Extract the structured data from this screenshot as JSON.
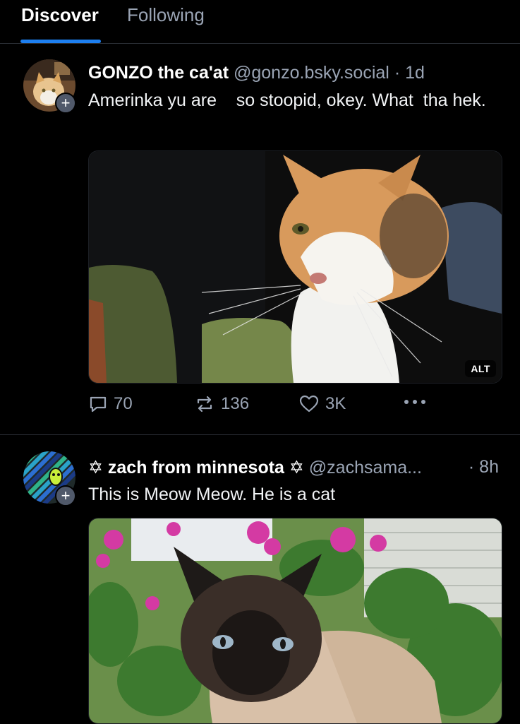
{
  "tabs": {
    "discover": "Discover",
    "following": "Following",
    "active_color": "#1d7ff0"
  },
  "posts": [
    {
      "author": "GONZO the ca'at",
      "handle": "@gonzo.bsky.social",
      "time": "· 1d",
      "text": "Amerinka yu are    so stoopid, okey. What  tha hek.",
      "alt_badge": "ALT",
      "reply_count": "70",
      "repost_count": "136",
      "like_count": "3K",
      "icons": [
        "reply-icon",
        "repost-icon",
        "heart-icon",
        "more-icon"
      ]
    },
    {
      "author": "✡ zach from minnesota ✡",
      "handle": "@zachsama...",
      "time": "· 8h",
      "text": "This is Meow Meow. He is a cat"
    }
  ],
  "avatar_plus": "+"
}
